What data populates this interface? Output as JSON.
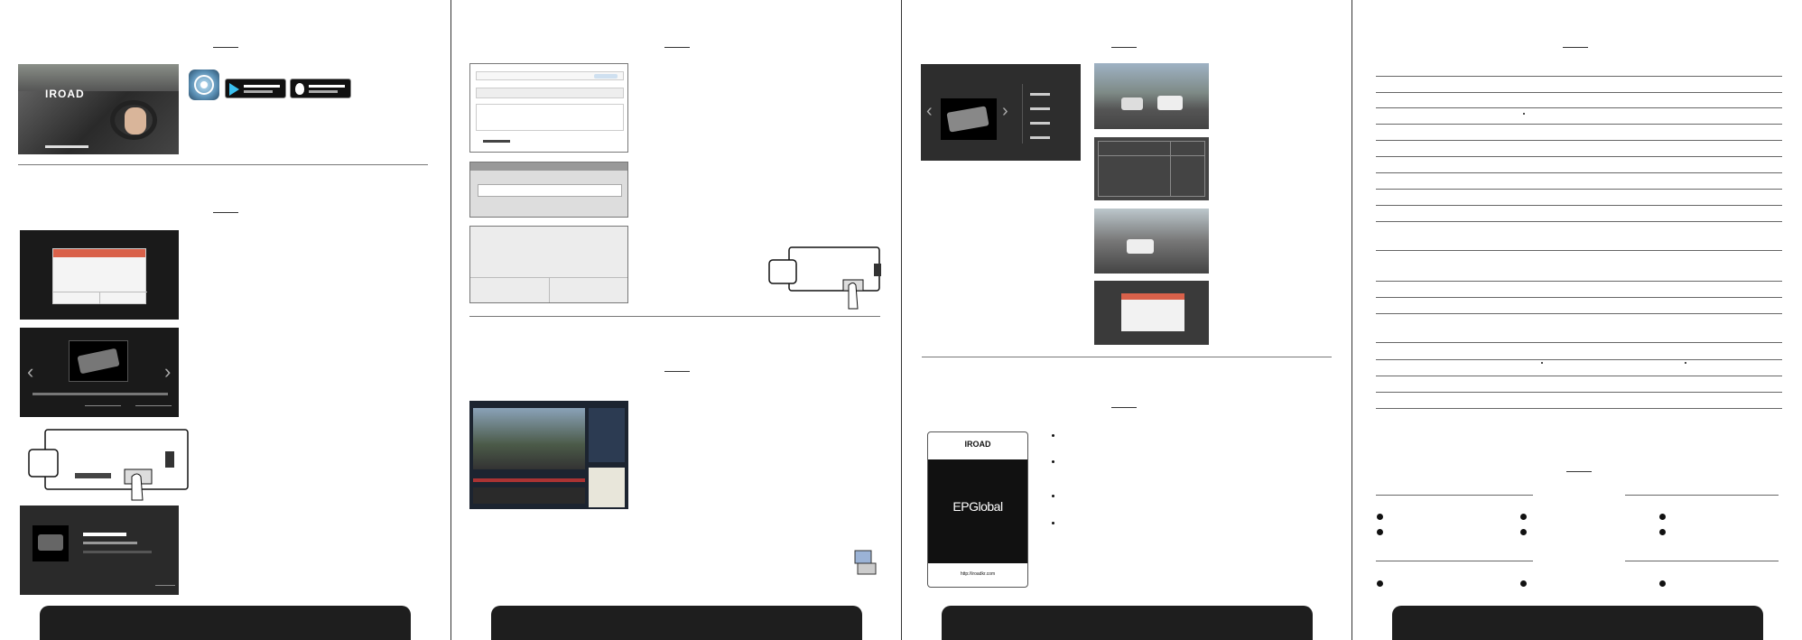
{
  "page": {
    "panels": 4
  },
  "panel1": {
    "video_logo": "IROAD",
    "store_badges": {
      "google_play_icon": "google-play-icon",
      "app_store_icon": "app-store-icon"
    }
  },
  "panel2": {
    "card_title_short": "",
    "viewer_note": ""
  },
  "panel3": {
    "brand_card": {
      "logo": "IROAD",
      "product": "EPGlobal",
      "url": "http://iroadkr.com"
    }
  },
  "panel4": {
    "spec_rows": 20
  },
  "colors": {
    "footer": "#1e1e1e",
    "dialog_header": "#d9614a",
    "divider": "#777777"
  }
}
